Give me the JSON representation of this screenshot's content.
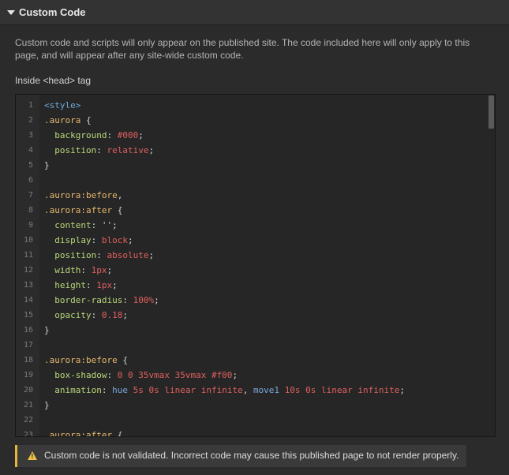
{
  "section": {
    "title": "Custom Code",
    "description": "Custom code and scripts will only appear on the published site. The code included here will only apply to this page, and will appear after any site-wide custom code."
  },
  "head_field": {
    "label": "Inside <head> tag"
  },
  "editor": {
    "lines": [
      [
        {
          "t": "tag",
          "v": "<style>"
        }
      ],
      [
        {
          "t": "sel",
          "v": ".aurora"
        },
        {
          "t": "p",
          "v": " {"
        }
      ],
      [
        {
          "t": "p",
          "v": "  "
        },
        {
          "t": "prop",
          "v": "background"
        },
        {
          "t": "p",
          "v": ": "
        },
        {
          "t": "val",
          "v": "#000"
        },
        {
          "t": "p",
          "v": ";"
        }
      ],
      [
        {
          "t": "p",
          "v": "  "
        },
        {
          "t": "prop",
          "v": "position"
        },
        {
          "t": "p",
          "v": ": "
        },
        {
          "t": "val",
          "v": "relative"
        },
        {
          "t": "p",
          "v": ";"
        }
      ],
      [
        {
          "t": "p",
          "v": "}"
        }
      ],
      [],
      [
        {
          "t": "sel",
          "v": ".aurora:before"
        },
        {
          "t": "p",
          "v": ","
        }
      ],
      [
        {
          "t": "sel",
          "v": ".aurora:after"
        },
        {
          "t": "p",
          "v": " {"
        }
      ],
      [
        {
          "t": "p",
          "v": "  "
        },
        {
          "t": "prop",
          "v": "content"
        },
        {
          "t": "p",
          "v": ": "
        },
        {
          "t": "str",
          "v": "''"
        },
        {
          "t": "p",
          "v": ";"
        }
      ],
      [
        {
          "t": "p",
          "v": "  "
        },
        {
          "t": "prop",
          "v": "display"
        },
        {
          "t": "p",
          "v": ": "
        },
        {
          "t": "val",
          "v": "block"
        },
        {
          "t": "p",
          "v": ";"
        }
      ],
      [
        {
          "t": "p",
          "v": "  "
        },
        {
          "t": "prop",
          "v": "position"
        },
        {
          "t": "p",
          "v": ": "
        },
        {
          "t": "val",
          "v": "absolute"
        },
        {
          "t": "p",
          "v": ";"
        }
      ],
      [
        {
          "t": "p",
          "v": "  "
        },
        {
          "t": "prop",
          "v": "width"
        },
        {
          "t": "p",
          "v": ": "
        },
        {
          "t": "val",
          "v": "1px"
        },
        {
          "t": "p",
          "v": ";"
        }
      ],
      [
        {
          "t": "p",
          "v": "  "
        },
        {
          "t": "prop",
          "v": "height"
        },
        {
          "t": "p",
          "v": ": "
        },
        {
          "t": "val",
          "v": "1px"
        },
        {
          "t": "p",
          "v": ";"
        }
      ],
      [
        {
          "t": "p",
          "v": "  "
        },
        {
          "t": "prop",
          "v": "border-radius"
        },
        {
          "t": "p",
          "v": ": "
        },
        {
          "t": "val",
          "v": "100%"
        },
        {
          "t": "p",
          "v": ";"
        }
      ],
      [
        {
          "t": "p",
          "v": "  "
        },
        {
          "t": "prop",
          "v": "opacity"
        },
        {
          "t": "p",
          "v": ": "
        },
        {
          "t": "val",
          "v": "0.18"
        },
        {
          "t": "p",
          "v": ";"
        }
      ],
      [
        {
          "t": "p",
          "v": "}"
        }
      ],
      [],
      [
        {
          "t": "sel",
          "v": ".aurora:before"
        },
        {
          "t": "p",
          "v": " {"
        }
      ],
      [
        {
          "t": "p",
          "v": "  "
        },
        {
          "t": "prop",
          "v": "box-shadow"
        },
        {
          "t": "p",
          "v": ": "
        },
        {
          "t": "val",
          "v": "0 0 35vmax 35vmax #f00"
        },
        {
          "t": "p",
          "v": ";"
        }
      ],
      [
        {
          "t": "p",
          "v": "  "
        },
        {
          "t": "prop",
          "v": "animation"
        },
        {
          "t": "p",
          "v": ": "
        },
        {
          "t": "fn",
          "v": "hue"
        },
        {
          "t": "p",
          "v": " "
        },
        {
          "t": "val",
          "v": "5s 0s linear infinite"
        },
        {
          "t": "p",
          "v": ", "
        },
        {
          "t": "fn",
          "v": "move1"
        },
        {
          "t": "p",
          "v": " "
        },
        {
          "t": "val",
          "v": "10s 0s linear infinite"
        },
        {
          "t": "p",
          "v": ";"
        }
      ],
      [
        {
          "t": "p",
          "v": "}"
        }
      ],
      [],
      [
        {
          "t": "sel",
          "v": ".aurora:after"
        },
        {
          "t": "p",
          "v": " {"
        }
      ]
    ]
  },
  "warning": {
    "icon": "warning-icon",
    "text": "Custom code is not validated. Incorrect code may cause this published page to not render properly.",
    "accent": "#e7b53d"
  }
}
